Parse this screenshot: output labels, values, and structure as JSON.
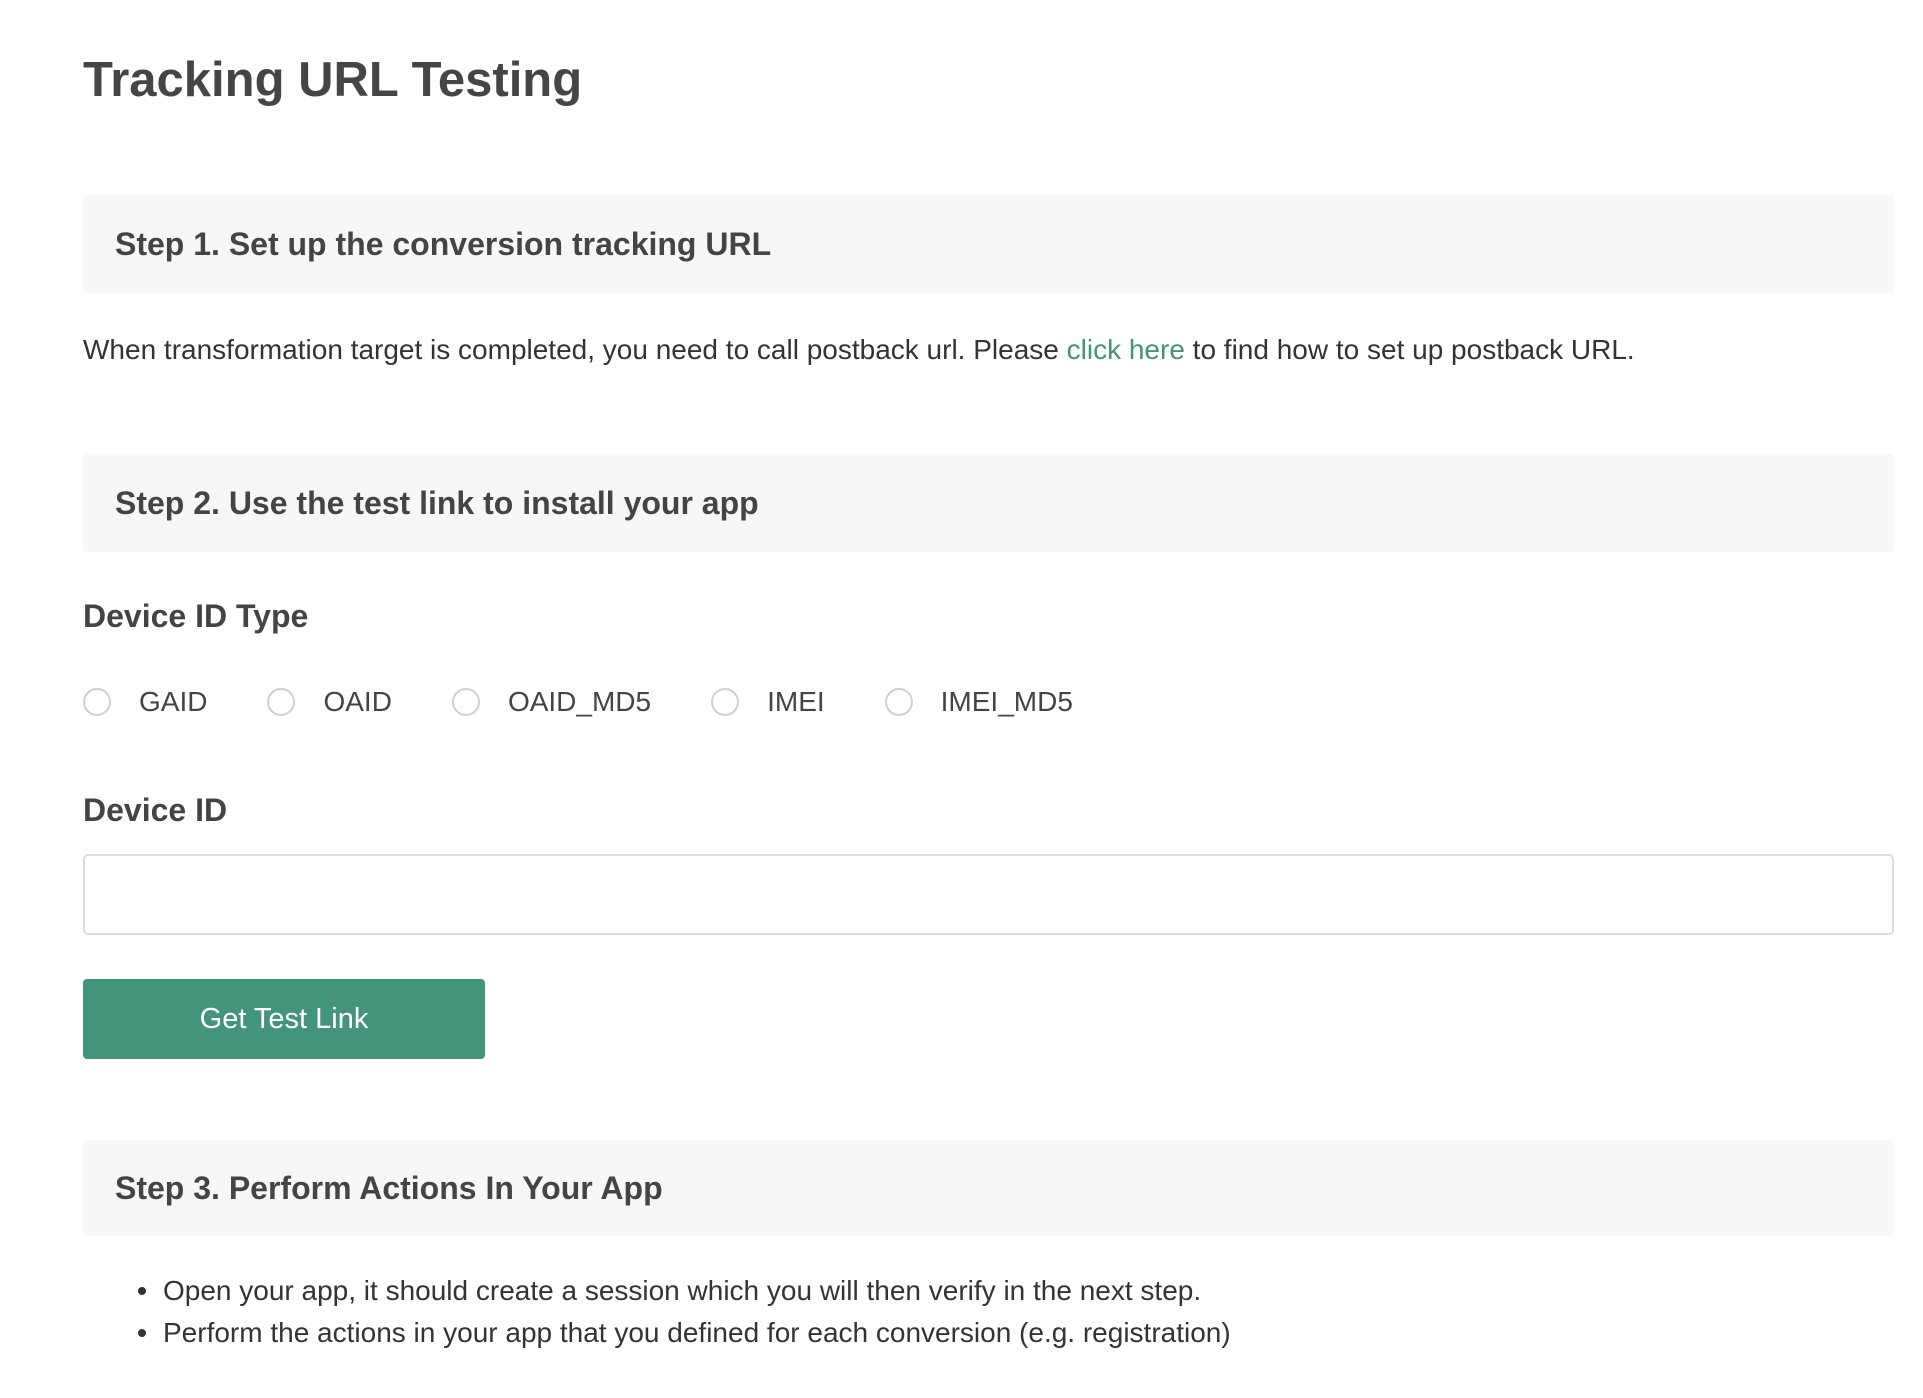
{
  "page": {
    "title": "Tracking URL Testing"
  },
  "step1": {
    "header": "Step 1. Set up the conversion tracking URL",
    "text_before": "When transformation target is completed, you need to call postback url. Please ",
    "link_text": "click here",
    "text_after": " to find how to set up postback URL."
  },
  "step2": {
    "header": "Step 2. Use the test link to install your app",
    "device_id_type_label": "Device ID Type",
    "device_id_types": [
      {
        "label": "GAID",
        "selected": false
      },
      {
        "label": "OAID",
        "selected": false
      },
      {
        "label": "OAID_MD5",
        "selected": false
      },
      {
        "label": "IMEI",
        "selected": false
      },
      {
        "label": "IMEI_MD5",
        "selected": false
      }
    ],
    "device_id_label": "Device ID",
    "device_id_value": "",
    "button_label": "Get Test Link"
  },
  "step3": {
    "header": "Step 3. Perform Actions In Your App",
    "items": [
      "Open your app, it should create a session which you will then verify in the next step.",
      "Perform the actions in your app that you defined for each conversion (e.g. registration)"
    ]
  },
  "colors": {
    "accent": "#42957a",
    "header_bg": "#f7f7f7",
    "text": "#333333"
  }
}
